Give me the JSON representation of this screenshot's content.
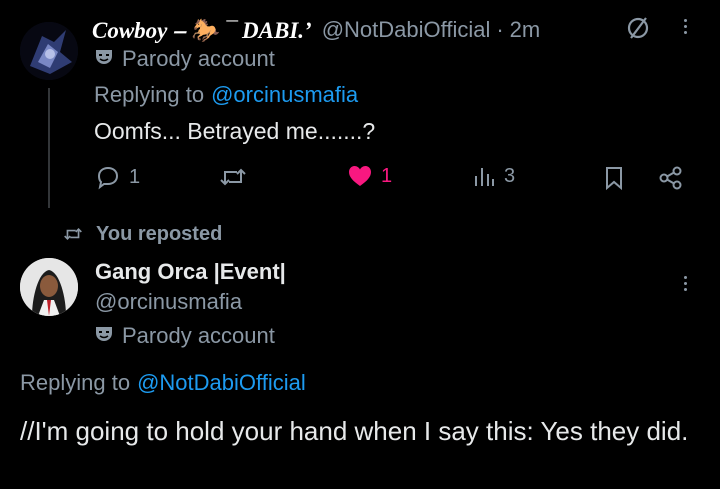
{
  "tweet1": {
    "display_name": "Cowboy ⎯ 🐎 ¯ DABI.’",
    "handle": "@NotDabiOfficial",
    "separator": "·",
    "time": "2m",
    "parody_label": "Parody account",
    "replying_prefix": "Replying to",
    "replying_to": "@orcinusmafia",
    "text": "Oomfs... Betrayed me.......?",
    "actions": {
      "replies": "1",
      "likes": "1",
      "views": "3"
    }
  },
  "repost_label": "You reposted",
  "tweet2": {
    "display_name": "Gang Orca |Event|",
    "handle": "@orcinusmafia",
    "parody_label": "Parody account",
    "replying_prefix": "Replying to",
    "replying_to": "@NotDabiOfficial",
    "text": "//I'm going to hold your hand when I say this: Yes they did."
  },
  "colors": {
    "background": "#000000",
    "text": "#e7e9ea",
    "muted": "#8b98a5",
    "link": "#1d9bf0",
    "like": "#f91880"
  },
  "icons": [
    "mask-icon",
    "reply-icon",
    "retweet-icon",
    "heart-icon",
    "views-icon",
    "bookmark-icon",
    "share-icon",
    "grok-icon",
    "more-icon"
  ]
}
